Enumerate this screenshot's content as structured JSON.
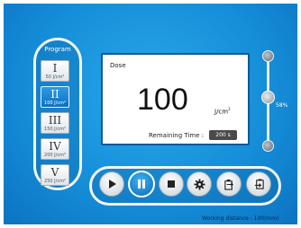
{
  "program": {
    "title": "Program",
    "items": [
      {
        "roman": "I",
        "dose": "50 J/cm²",
        "selected": false
      },
      {
        "roman": "II",
        "dose": "100 J/cm²",
        "selected": true
      },
      {
        "roman": "III",
        "dose": "150 J/cm²",
        "selected": false
      },
      {
        "roman": "IV",
        "dose": "200 J/cm²",
        "selected": false
      },
      {
        "roman": "V",
        "dose": "250 J/cm²",
        "selected": false
      }
    ]
  },
  "dose": {
    "label": "Dose",
    "value": "100",
    "unit": "J/cm",
    "unit_sup": "2",
    "remaining_label": "Remaining Time :",
    "remaining_value": "200 s"
  },
  "intensity": {
    "label": "58%",
    "level": 0.58
  },
  "controls": [
    {
      "name": "play-icon",
      "active": false
    },
    {
      "name": "pause-icon",
      "active": true
    },
    {
      "name": "stop-icon",
      "active": false
    },
    {
      "name": "settings-icon",
      "active": false
    },
    {
      "name": "export-icon",
      "active": false
    },
    {
      "name": "import-icon",
      "active": false
    }
  ],
  "footer": {
    "working_distance": "Working distance : 100(mm)"
  },
  "colors": {
    "background": "#168fd9",
    "selected_program": "#0e6fc0",
    "remaining_bg": "#4a4a4a"
  }
}
